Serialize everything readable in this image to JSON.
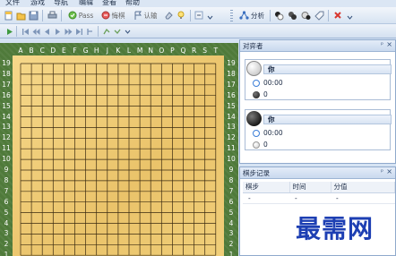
{
  "menu": [
    "文件",
    "游戏",
    "导航",
    "编辑",
    "查看",
    "帮助"
  ],
  "toolbar": {
    "pass_label": "Pass",
    "undo_label": "悔棋",
    "resign_label": "认输",
    "analyze_label": "分析"
  },
  "board": {
    "columns": [
      "A",
      "B",
      "C",
      "D",
      "E",
      "F",
      "G",
      "H",
      "J",
      "K",
      "L",
      "M",
      "N",
      "O",
      "P",
      "Q",
      "R",
      "S",
      "T"
    ],
    "rows": [
      "19",
      "18",
      "17",
      "16",
      "15",
      "14",
      "13",
      "12",
      "11",
      "10",
      "9",
      "8",
      "7",
      "6",
      "5",
      "4",
      "3",
      "2",
      "1"
    ]
  },
  "opponents_panel": {
    "title": "对弈者",
    "pin_icon": "pin-icon",
    "close_icon": "close-icon",
    "white_player": {
      "name": "你",
      "time": "00:00",
      "captures": "0"
    },
    "black_player": {
      "name": "你",
      "time": "00:00",
      "captures": "0"
    }
  },
  "moves_panel": {
    "title": "棋步记录",
    "columns": [
      "棋步",
      "时间",
      "分值"
    ],
    "rows": [
      [
        "-",
        "-",
        "-"
      ]
    ]
  },
  "watermark": "最需网",
  "colors": {
    "board": "#eac36a",
    "frame": "#4f7a3a",
    "accent": "#3b7ed8"
  }
}
